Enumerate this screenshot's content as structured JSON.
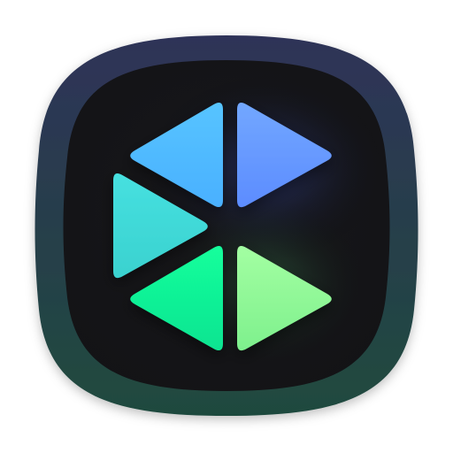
{
  "icon": {
    "name": "app-icon",
    "shape": "squircle",
    "colors": {
      "outer_top": "#2f3358",
      "outer_bottom": "#1f4a3e",
      "inner_top": "#17171a",
      "inner_bottom": "#131316",
      "glow_blue": "#4d6bff",
      "glow_green": "#66ff99"
    },
    "triangles": [
      {
        "name": "triangle-top-left",
        "color_top": "#56c4ff",
        "color_bottom": "#4ab0ff",
        "direction": "left"
      },
      {
        "name": "triangle-top-right",
        "color_top": "#72a7ff",
        "color_bottom": "#5c8cff",
        "direction": "right"
      },
      {
        "name": "triangle-middle-left",
        "color_top": "#46e0e0",
        "color_bottom": "#3ad2cf",
        "direction": "right"
      },
      {
        "name": "triangle-bottom-left",
        "color_top": "#12ff9c",
        "color_bottom": "#10e491",
        "direction": "left"
      },
      {
        "name": "triangle-bottom-right",
        "color_top": "#a3ffa2",
        "color_bottom": "#7ef08d",
        "direction": "right"
      }
    ]
  }
}
